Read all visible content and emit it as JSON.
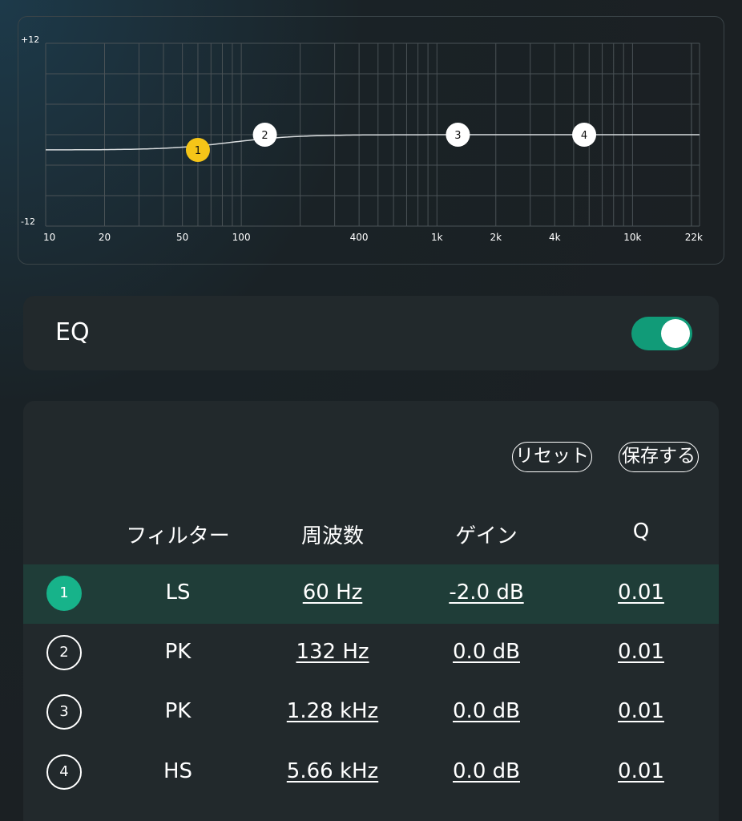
{
  "graph": {
    "y_max_label": "+12",
    "y_min_label": "-12",
    "x_ticks": [
      "10",
      "20",
      "50",
      "100",
      "400",
      "1k",
      "2k",
      "4k",
      "10k",
      "22k"
    ],
    "nodes": [
      {
        "id": "1",
        "freq_hz": 60,
        "gain_db": -2.0,
        "active": true
      },
      {
        "id": "2",
        "freq_hz": 132,
        "gain_db": 0.0,
        "active": false
      },
      {
        "id": "3",
        "freq_hz": 1280,
        "gain_db": 0.0,
        "active": false
      },
      {
        "id": "4",
        "freq_hz": 5660,
        "gain_db": 0.0,
        "active": false
      }
    ],
    "colors": {
      "active_node": "#f5c518",
      "node": "#ffffff",
      "curve": "#d8dcde",
      "grid": "#4a5256"
    }
  },
  "eq": {
    "label": "EQ",
    "enabled": true,
    "toggle_color": "#119b78"
  },
  "actions": {
    "reset": "リセット",
    "save": "保存する"
  },
  "table": {
    "headers": {
      "filter": "フィルター",
      "frequency": "周波数",
      "gain": "ゲイン",
      "q": "Q"
    },
    "rows": [
      {
        "index": "1",
        "filter": "LS",
        "frequency": "60 Hz",
        "gain": "-2.0 dB",
        "q": "0.01"
      },
      {
        "index": "2",
        "filter": "PK",
        "frequency": "132 Hz",
        "gain": "0.0 dB",
        "q": "0.01"
      },
      {
        "index": "3",
        "filter": "PK",
        "frequency": "1.28 kHz",
        "gain": "0.0 dB",
        "q": "0.01"
      },
      {
        "index": "4",
        "filter": "HS",
        "frequency": "5.66 kHz",
        "gain": "0.0 dB",
        "q": "0.01"
      }
    ],
    "selected_index": 0,
    "accent": "#17b38a"
  }
}
